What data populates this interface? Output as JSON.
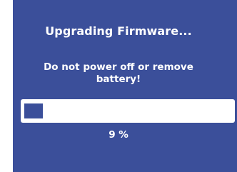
{
  "dialog": {
    "title": "Upgrading Firmware...",
    "warning_line1": "Do not power off or remove",
    "warning_line2": "battery!",
    "progress_fraction": 0.09,
    "progress_label": "9 %"
  },
  "colors": {
    "background": "#3b4f9a",
    "text": "#ffffff",
    "track": "#ffffff",
    "fill": "#3b4f9a"
  }
}
